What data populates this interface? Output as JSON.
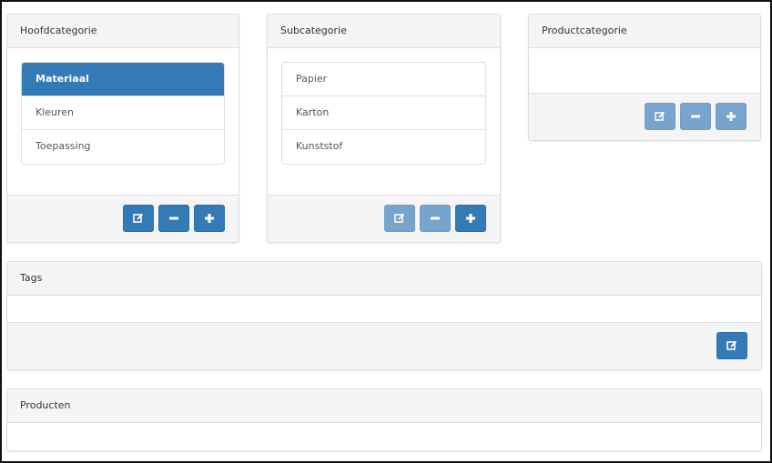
{
  "panels": {
    "hoofdcategorie": {
      "title": "Hoofdcategorie",
      "items": [
        "Materiaal",
        "Kleuren",
        "Toepassing"
      ],
      "active_item": "Materiaal"
    },
    "subcategorie": {
      "title": "Subcategorie",
      "items": [
        "Papier",
        "Karton",
        "Kunststof"
      ]
    },
    "productcategorie": {
      "title": "Productcategorie",
      "items": []
    },
    "tags": {
      "title": "Tags"
    },
    "producten": {
      "title": "Producten"
    }
  },
  "buttons": {
    "hoofdcategorie": [
      {
        "icon": "edit-icon",
        "enabled": true
      },
      {
        "icon": "minus-icon",
        "enabled": true
      },
      {
        "icon": "plus-icon",
        "enabled": true
      }
    ],
    "subcategorie": [
      {
        "icon": "edit-icon",
        "enabled": false
      },
      {
        "icon": "minus-icon",
        "enabled": false
      },
      {
        "icon": "plus-icon",
        "enabled": true
      }
    ],
    "productcategorie": [
      {
        "icon": "edit-icon",
        "enabled": false
      },
      {
        "icon": "minus-icon",
        "enabled": false
      },
      {
        "icon": "plus-icon",
        "enabled": false
      }
    ],
    "tags": [
      {
        "icon": "edit-icon",
        "enabled": true
      }
    ]
  },
  "colors": {
    "primary": "#337ab7",
    "panel_heading_bg": "#f5f5f5",
    "border": "#dddddd"
  }
}
